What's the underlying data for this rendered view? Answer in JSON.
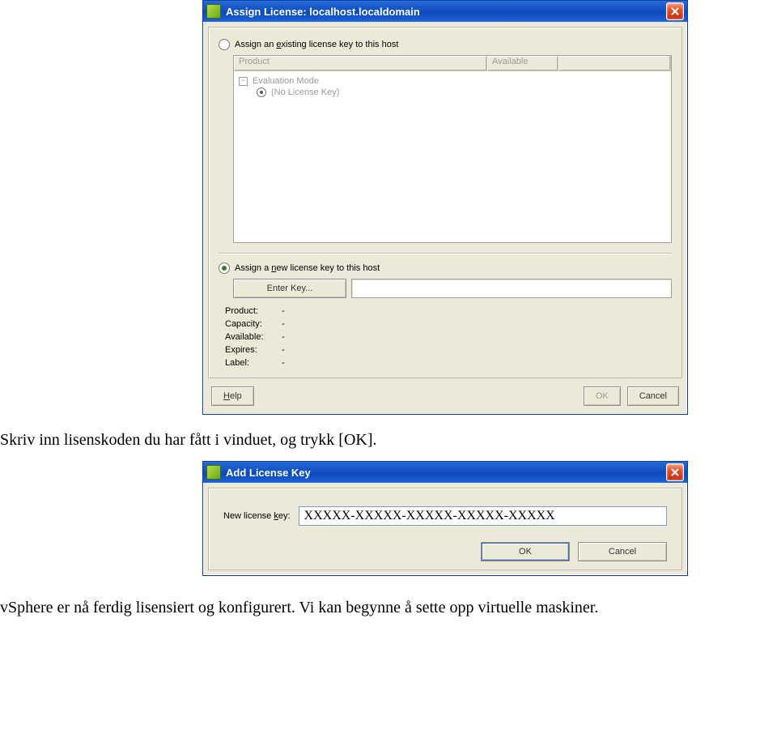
{
  "dlg1": {
    "title": "Assign License: localhost.localdomain",
    "radio_existing": "Assign an existing license key to this host",
    "radio_new": "Assign a new license key to this host",
    "col_product": "Product",
    "col_available": "Available",
    "tree_eval": "Evaluation Mode",
    "tree_nokey": "(No License Key)",
    "enter_key_btn": "Enter Key...",
    "kv": {
      "product_k": "Product:",
      "product_v": "-",
      "capacity_k": "Capacity:",
      "capacity_v": "-",
      "available_k": "Available:",
      "available_v": "-",
      "expires_k": "Expires:",
      "expires_v": "-",
      "label_k": "Label:",
      "label_v": "-"
    },
    "help": "Help",
    "ok": "OK",
    "cancel": "Cancel"
  },
  "text1": "Skriv inn lisenskoden du har fått i vinduet, og trykk [OK].",
  "dlg2": {
    "title": "Add License Key",
    "label": "New license key:",
    "value": "XXXXX-XXXXX-XXXXX-XXXXX-XXXXX",
    "ok": "OK",
    "cancel": "Cancel"
  },
  "text2": "vSphere er nå ferdig lisensiert og konfigurert. Vi kan begynne å sette opp virtuelle maskiner."
}
